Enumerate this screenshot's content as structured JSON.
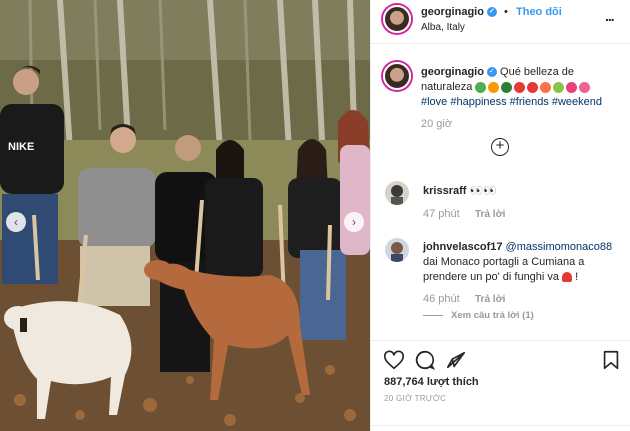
{
  "post": {
    "username": "georginagio",
    "follow_label": "Theo dõi",
    "location": "Alba, Italy",
    "separator": "•",
    "more_label": "...",
    "caption_text": "Qué belleza de naturaleza",
    "caption_emojis": [
      "#4caf50",
      "#ff9800",
      "#2e7d32",
      "#e53935",
      "#e53935",
      "#ff7043",
      "#8bc34a",
      "#ec407a",
      "#f06292"
    ],
    "hashtags": "#love #happiness #friends #weekend",
    "caption_time": "20 giờ"
  },
  "comments": [
    {
      "username": "krissraff",
      "text": "👀👀",
      "time": "47 phút",
      "reply_label": "Trả lời"
    },
    {
      "username": "johnvelascof17",
      "mention": "@massimomonaco88",
      "text": "dai Monaco portagli a Cumiana a prendere un po' di funghi va",
      "time": "46 phút",
      "reply_label": "Trả lời",
      "view_replies": "Xem câu trả lời (1)"
    }
  ],
  "actions": {
    "likes": "887,764 lượt thích",
    "posted_ago": "20 GIỜ TRƯỚC"
  },
  "photo": {
    "shirt_text": "NIKE"
  },
  "colors": {
    "link": "#3897f0",
    "hashtag": "#003569",
    "muted": "#999999",
    "text": "#262626"
  }
}
